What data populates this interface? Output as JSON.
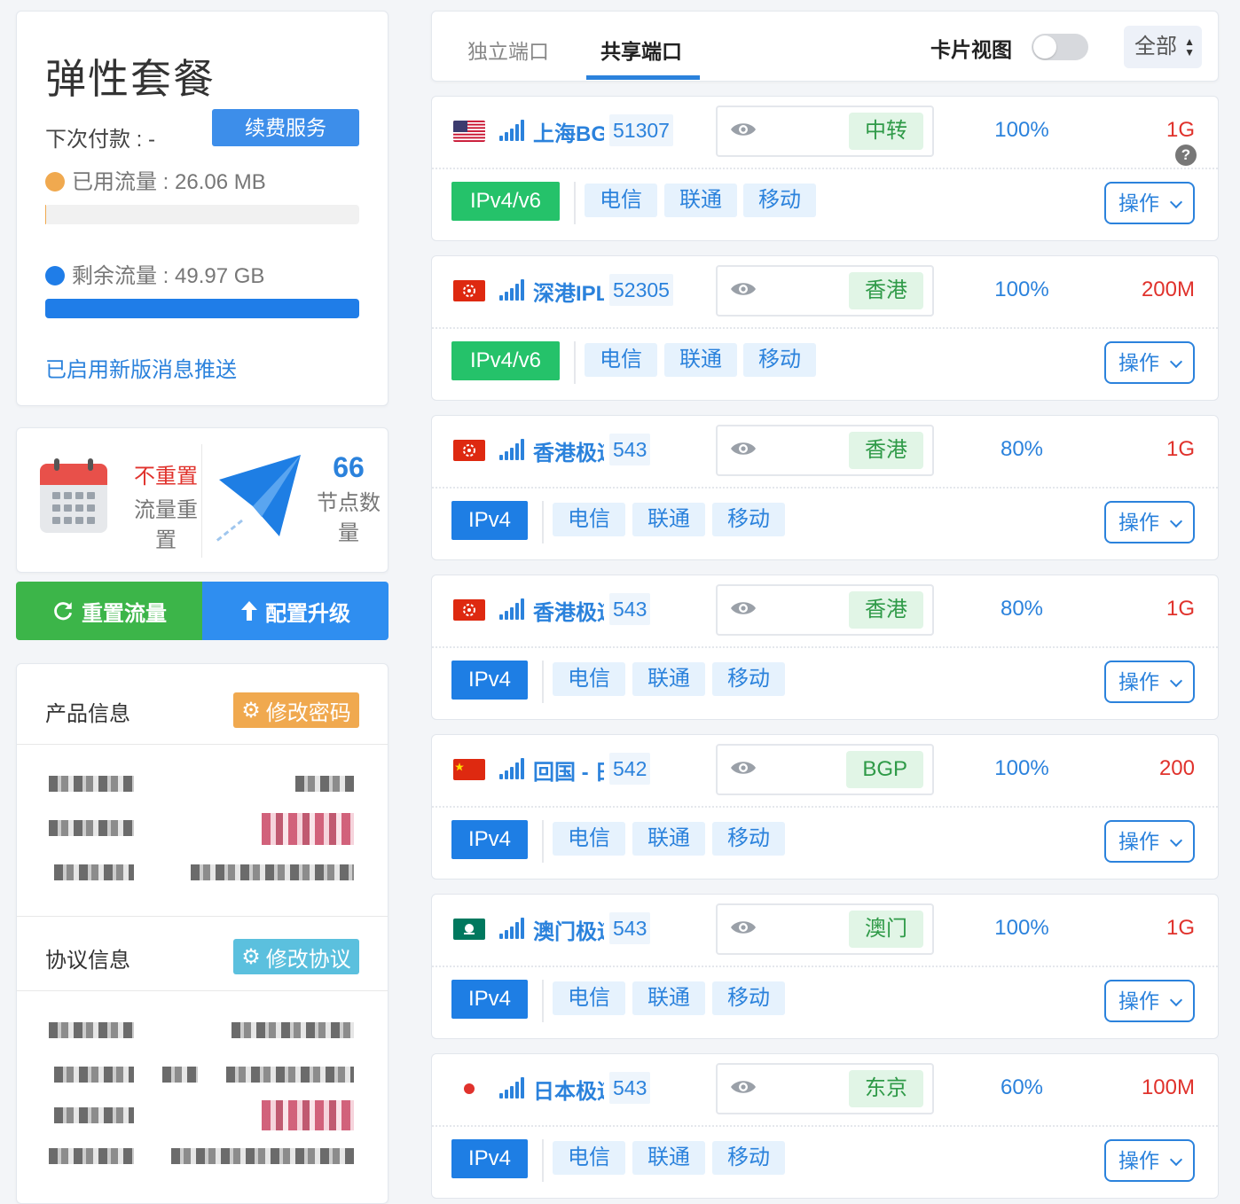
{
  "plan": {
    "title": "弹性套餐",
    "next_payment": "下次付款 : -",
    "renew_button": "续费服务",
    "used_traffic": "已用流量 : 26.06 MB",
    "used_fraction": 0.0005,
    "remaining_traffic": "剩余流量 : 49.97 GB",
    "remaining_fraction": 0.9995,
    "notice_link": "已启用新版消息推送",
    "colors": {
      "used": "#f0a94f",
      "remaining": "#1f7de8"
    }
  },
  "stats": {
    "reset_value": "不重置",
    "reset_label": "流量重置",
    "node_count": "66",
    "node_label": "节点数量"
  },
  "actions": {
    "reset_traffic": "重置流量",
    "upgrade": "配置升级"
  },
  "info": {
    "product_title": "产品信息",
    "change_password": "修改密码",
    "protocol_title": "协议信息",
    "change_protocol": "修改协议"
  },
  "tabs": {
    "dedicated": "独立端口",
    "shared": "共享端口",
    "card_view": "卡片视图",
    "card_view_on": false,
    "filter": "全部"
  },
  "isp_labels": [
    "电信",
    "联通",
    "移动"
  ],
  "operate_label": "操作",
  "nodes": [
    {
      "flag": "us",
      "name": "上海BGP",
      "port": "51307",
      "region": "中转",
      "ratio": "100%",
      "bandwidth": "1G",
      "ip": "IPv4/v6",
      "help": "?"
    },
    {
      "flag": "hk",
      "name": "深港IPLC",
      "port": "52305",
      "region": "香港",
      "ratio": "100%",
      "bandwidth": "200M",
      "ip": "IPv4/v6"
    },
    {
      "flag": "hk",
      "name": "香港极速",
      "port": "543",
      "region": "香港",
      "ratio": "80%",
      "bandwidth": "1G",
      "ip": "IPv4"
    },
    {
      "flag": "hk",
      "name": "香港极速",
      "port": "543",
      "region": "香港",
      "ratio": "80%",
      "bandwidth": "1G",
      "ip": "IPv4"
    },
    {
      "flag": "cn",
      "name": "回国 - 日本",
      "port": "542",
      "region": "BGP",
      "ratio": "100%",
      "bandwidth": "200",
      "ip": "IPv4"
    },
    {
      "flag": "mo",
      "name": "澳门极速",
      "port": "543",
      "region": "澳门",
      "ratio": "100%",
      "bandwidth": "1G",
      "ip": "IPv4"
    },
    {
      "flag": "jp",
      "name": "日本极速",
      "port": "543",
      "region": "东京",
      "ratio": "60%",
      "bandwidth": "100M",
      "ip": "IPv4"
    }
  ]
}
